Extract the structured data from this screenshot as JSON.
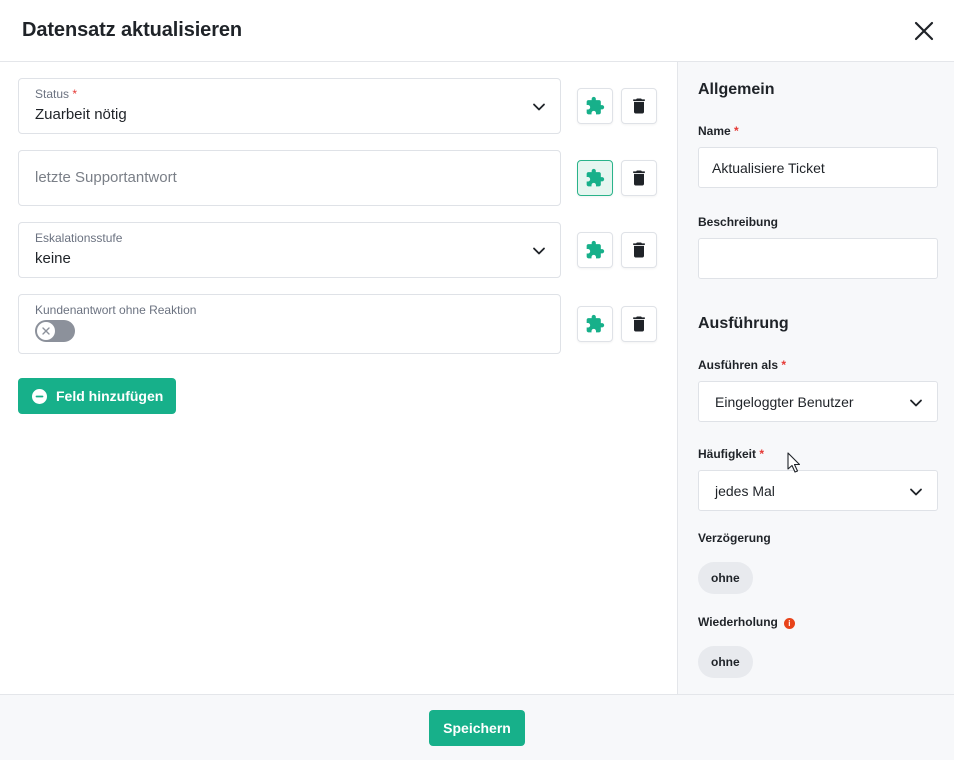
{
  "header": {
    "title": "Datensatz aktualisieren"
  },
  "fields": [
    {
      "label": "Status",
      "required": "*",
      "value": "Zuarbeit nötig"
    },
    {
      "placeholder": "letzte Supportantwort"
    },
    {
      "label": "Eskalationsstufe",
      "value": "keine"
    },
    {
      "label": "Kundenantwort ohne Reaktion",
      "toggle_on": false
    }
  ],
  "add_field_label": "Feld hinzufügen",
  "sidebar": {
    "general_title": "Allgemein",
    "name_label": "Name",
    "name_required": "*",
    "name_value": "Aktualisiere Ticket",
    "description_label": "Beschreibung",
    "description_value": "",
    "execution_title": "Ausführung",
    "run_as_label": "Ausführen als",
    "run_as_required": "*",
    "run_as_value": "Eingeloggter Benutzer",
    "frequency_label": "Häufigkeit",
    "frequency_required": "*",
    "frequency_value": "jedes Mal",
    "delay_label": "Verzögerung",
    "delay_value": "ohne",
    "repeat_label": "Wiederholung",
    "repeat_info": "i",
    "repeat_value": "ohne"
  },
  "footer": {
    "save_label": "Speichern"
  },
  "colors": {
    "accent": "#17b08a",
    "required": "#e53935",
    "info": "#e8431a"
  }
}
